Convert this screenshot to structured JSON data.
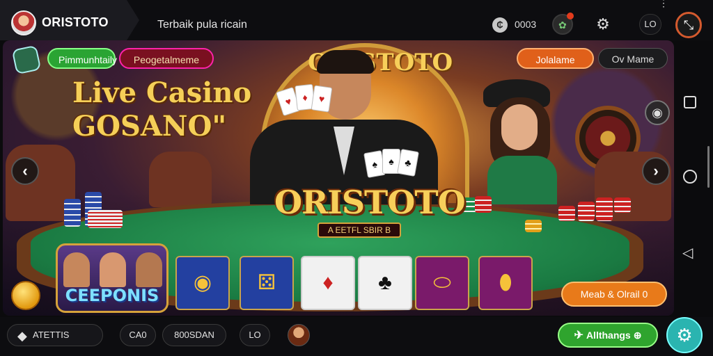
{
  "header": {
    "brand": "ORISTOTO",
    "title": "Terbaik pula ricain",
    "coins_icon": "coin-icon",
    "coins_value": "0003",
    "lo_label": "LO",
    "more_label": "⋮"
  },
  "banner": {
    "pill_green": "Pimmunhtaily",
    "pill_red": "Peogetalmeme",
    "pill_orange": "Jolalame",
    "pill_dark": "Ov Mame",
    "arch_title": "ORISTOTO",
    "live_title_line1": "Live Casino",
    "live_title_line2": "GOSANO\"",
    "main_logo": "ORISTOTO",
    "main_logo_sub": "A EETFL SBIR B",
    "champions_label": "CEEPONIS",
    "promo_button": "Meab & Olrail 0",
    "tiles": [
      "coin-tile",
      "dice-tile",
      "heart-card-tile",
      "spade-card-tile",
      "chip-tile",
      "gold-coin-tile"
    ]
  },
  "bottombar": {
    "exit_label": "ATETTIS",
    "cao_label": "CA0",
    "boos_label": "800SDAN",
    "lo_label": "LO",
    "green_label": "Allthangs"
  },
  "colors": {
    "accent_orange": "#e0601a",
    "accent_green": "#2fa42e",
    "gold": "#f5cf58",
    "teal": "#2ab4b0",
    "exit_ring": "#d45a2e"
  }
}
